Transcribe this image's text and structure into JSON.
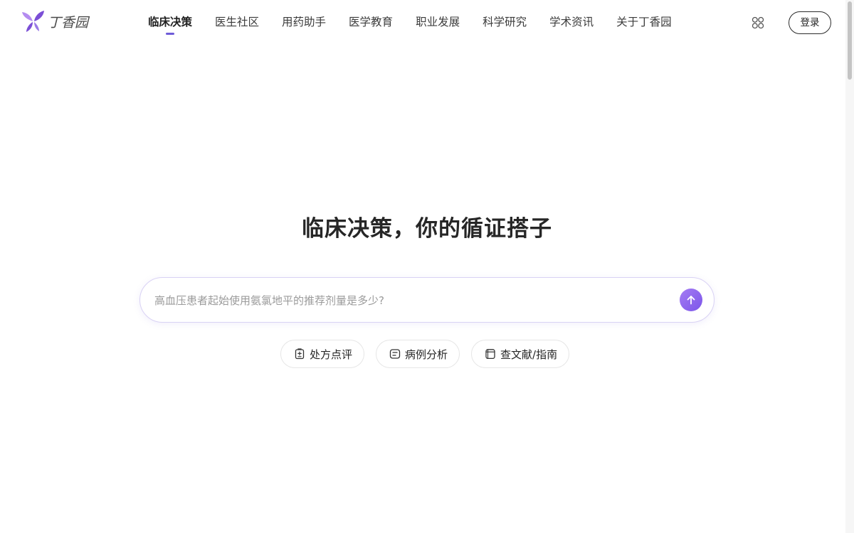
{
  "brand": {
    "name": "丁香园",
    "logo_colors": [
      "#7b4fd6",
      "#b48cf0",
      "#9b7be6"
    ]
  },
  "nav": {
    "active_color": "#6e5bd8",
    "items": [
      {
        "label": "临床决策",
        "active": true
      },
      {
        "label": "医生社区",
        "active": false
      },
      {
        "label": "用药助手",
        "active": false
      },
      {
        "label": "医学教育",
        "active": false
      },
      {
        "label": "职业发展",
        "active": false
      },
      {
        "label": "科学研究",
        "active": false
      },
      {
        "label": "学术资讯",
        "active": false
      },
      {
        "label": "关于丁香园",
        "active": false
      }
    ]
  },
  "header": {
    "apps_icon": "grid-apps-icon",
    "login_label": "登录"
  },
  "hero": {
    "headline": "临床决策，你的循证搭子",
    "search": {
      "value": "",
      "placeholder": "高血压患者起始使用氨氯地平的推荐剂量是多少?",
      "send_icon": "arrow-up-icon",
      "send_color": "#8a63ee"
    },
    "chips": [
      {
        "label": "处方点评",
        "icon": "prescription-review-icon"
      },
      {
        "label": "病例分析",
        "icon": "case-analysis-icon"
      },
      {
        "label": "查文献/指南",
        "icon": "literature-search-icon"
      }
    ]
  }
}
